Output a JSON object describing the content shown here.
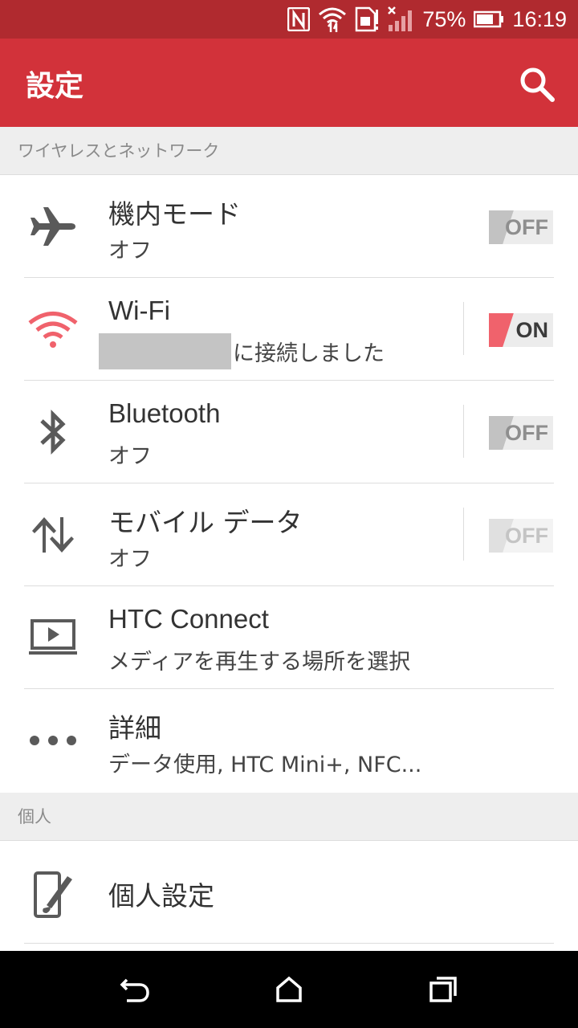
{
  "status_bar": {
    "battery_percent": "75%",
    "time": "16:19",
    "icons": [
      "nfc-icon",
      "wifi-icon",
      "sim-icon",
      "no-signal-icon",
      "battery-icon"
    ]
  },
  "app_bar": {
    "title": "設定",
    "search_icon": "search-icon"
  },
  "sections": [
    {
      "header": "ワイヤレスとネットワーク"
    },
    {
      "header": "個人"
    }
  ],
  "rows": [
    {
      "icon": "airplane-icon",
      "title": "機内モード",
      "subtitle": "オフ",
      "toggle": "OFF",
      "toggle_state": "off"
    },
    {
      "icon": "wifi-icon",
      "title": "Wi-Fi",
      "subtitle": "に接続しました",
      "toggle": "ON",
      "toggle_state": "on"
    },
    {
      "icon": "bluetooth-icon",
      "title": "Bluetooth",
      "subtitle": "オフ",
      "toggle": "OFF",
      "toggle_state": "off"
    },
    {
      "icon": "mobile-data-icon",
      "title": "モバイル データ",
      "subtitle": "オフ",
      "toggle": "OFF",
      "toggle_state": "disabled"
    },
    {
      "icon": "htc-connect-icon",
      "title": "HTC Connect",
      "subtitle": "メディアを再生する場所を選択"
    },
    {
      "icon": "more-icon",
      "title": "詳細",
      "subtitle": "データ使用, HTC Mini+, NFC..."
    },
    {
      "icon": "personalize-icon",
      "title": "個人設定"
    }
  ],
  "colors": {
    "status_bar": "#b02a2f",
    "app_bar": "#d2323a",
    "accent_on": "#f0626c",
    "wifi_icon": "#f0626c",
    "icon_gray": "#5a5a5a"
  },
  "nav_bar": {
    "buttons": [
      "back-icon",
      "home-icon",
      "recents-icon"
    ]
  }
}
